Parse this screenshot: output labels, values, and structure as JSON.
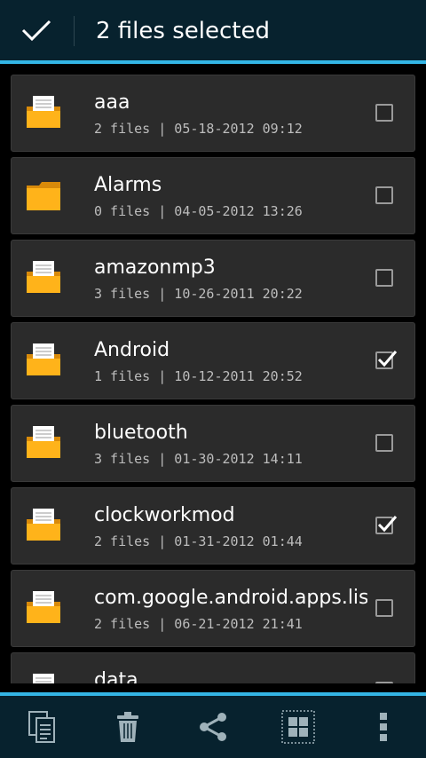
{
  "action_bar": {
    "title": "2 files selected",
    "done_icon": "checkmark-icon"
  },
  "files": [
    {
      "name": "aaa",
      "meta": "2 files | 05-18-2012 09:12",
      "icon": "folder-with-files-icon",
      "checked": false
    },
    {
      "name": "Alarms",
      "meta": "0 files | 04-05-2012 13:26",
      "icon": "empty-folder-icon",
      "checked": false
    },
    {
      "name": "amazonmp3",
      "meta": "3 files | 10-26-2011 20:22",
      "icon": "folder-with-files-icon",
      "checked": false
    },
    {
      "name": "Android",
      "meta": "1 files | 10-12-2011 20:52",
      "icon": "folder-with-files-icon",
      "checked": true
    },
    {
      "name": "bluetooth",
      "meta": "3 files | 01-30-2012 14:11",
      "icon": "folder-with-files-icon",
      "checked": false
    },
    {
      "name": "clockworkmod",
      "meta": "2 files | 01-31-2012 01:44",
      "icon": "folder-with-files-icon",
      "checked": true
    },
    {
      "name": "com.google.android.apps.listen",
      "meta": "2 files | 06-21-2012 21:41",
      "icon": "folder-with-files-icon",
      "checked": false
    },
    {
      "name": "data",
      "meta": "",
      "icon": "folder-with-files-icon",
      "checked": false
    }
  ],
  "bottom_actions": [
    {
      "icon": "copy-icon"
    },
    {
      "icon": "trash-icon"
    },
    {
      "icon": "share-icon"
    },
    {
      "icon": "select-all-icon"
    },
    {
      "icon": "overflow-menu-icon"
    }
  ],
  "colors": {
    "bar_background": "#07222e",
    "accent": "#33b5e5",
    "row_background": "#2b2b2b",
    "folder": "#ffb31a"
  }
}
